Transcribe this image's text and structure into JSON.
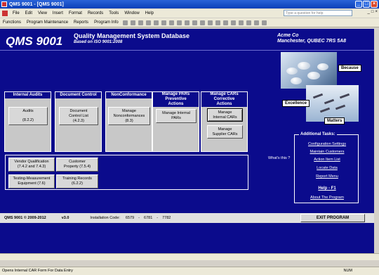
{
  "window": {
    "title": "QMS 9001 - [QMS 9001]"
  },
  "menu": [
    "File",
    "Edit",
    "View",
    "Insert",
    "Format",
    "Records",
    "Tools",
    "Window",
    "Help"
  ],
  "help_placeholder": "Type a question for help",
  "toolbar": [
    "Functions",
    "Program Maintenance",
    "Reports",
    "Program Info"
  ],
  "header": {
    "logo": "QMS 9001",
    "title": "Quality Management System Database",
    "subtitle": "Based on ISO 9001:2008",
    "company": "Acme Co",
    "location": "Manchester, QUBEC  7RS 5A8"
  },
  "images": {
    "label1": "Because",
    "label2": "Excellence",
    "label3": "Matters"
  },
  "sections": {
    "internal_audits": {
      "title": "Internal Audits",
      "btn1": "Audits",
      "btn1_ref": "(8.2.2)"
    },
    "document_control": {
      "title": "Document Control",
      "btn1": "Document Control List",
      "btn1_ref": "(4.2.3)"
    },
    "nonconformance": {
      "title": "NonConformance",
      "btn1": "Manage Nonconformances",
      "btn1_ref": "(8.3)"
    },
    "pars": {
      "title": "Manage PARs Preventive Actions",
      "btn1": "Manage Internal PARs"
    },
    "cars": {
      "title": "Manage CARs Corrective Actions",
      "btn1": "Manage Internal CARs",
      "btn2": "Manage Supplier CARs"
    }
  },
  "panel": {
    "vendor": "Vendor Qualification (7.4.2 and 7.4.3)",
    "customer": "Customer Property (7.5.4)",
    "testing": "Testing-Measurement Equipment (7.6)",
    "training": "Training Records (6.2.2)"
  },
  "whats_this": "What's this ?",
  "tasks": {
    "title": "Additional Tasks:",
    "items": [
      "Configuration Settings",
      "Maintain Customers",
      "Action Item List",
      "Locate Data",
      "Report Menu"
    ],
    "help": "Help - F1",
    "about": "About The Program"
  },
  "footer": {
    "copyright": "QMS 9001 © 2009-2012",
    "version": "v3.0",
    "install_label": "Installation Code:",
    "codes": [
      "6579",
      "6781",
      "7782"
    ],
    "exit": "EXIT PROGRAM"
  },
  "status": {
    "text": "Opens Internal CAR Form For Data Entry",
    "num": "NUM"
  }
}
